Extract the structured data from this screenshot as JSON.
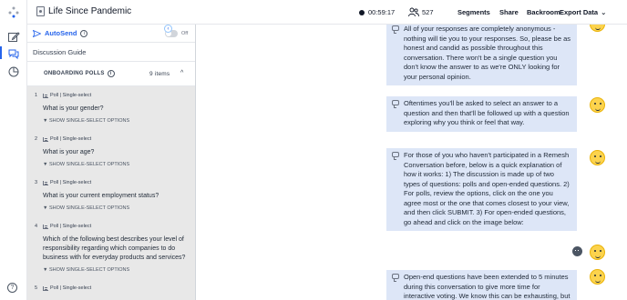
{
  "header": {
    "title": "Life Since Pandemic",
    "timer": "00:59:17",
    "participant_count": "527",
    "links": [
      "Segments",
      "Share",
      "Backroom",
      "Export Data"
    ]
  },
  "sidebar": {
    "icons": [
      "remesh-logo-icon",
      "edit-icon",
      "conversation-icon",
      "chart-icon",
      "help-icon"
    ],
    "help_glyph": "?"
  },
  "panel": {
    "autosend_label": "AutoSend",
    "toggle_state": "Off",
    "guide_title": "Discussion Guide",
    "polls_header": "ONBOARDING POLLS",
    "polls_count": "9 items",
    "polls": [
      {
        "num": "1",
        "type": "Poll | Single-select",
        "question": "What is your gender?",
        "options_label": "▼ SHOW SINGLE-SELECT OPTIONS"
      },
      {
        "num": "2",
        "type": "Poll | Single-select",
        "question": "What is your age?",
        "options_label": "▼ SHOW SINGLE-SELECT OPTIONS"
      },
      {
        "num": "3",
        "type": "Poll | Single-select",
        "question": "What is your current employment status?",
        "options_label": "▼ SHOW SINGLE-SELECT OPTIONS"
      },
      {
        "num": "4",
        "type": "Poll | Single-select",
        "question": "Which of the following best describes your level of responsibility regarding which companies to do business with for everyday products and services?",
        "options_label": "▼ SHOW SINGLE-SELECT OPTIONS"
      },
      {
        "num": "5",
        "type": "Poll | Single-select",
        "question": "",
        "options_label": ""
      }
    ]
  },
  "chat": {
    "messages": [
      {
        "text": "All of your responses are completely anonymous - nothing will tie you to your responses. So, please be as honest and candid as possible throughout this conversation. There won't be a single question you don't know the answer to as we're ONLY looking for your personal opinion."
      },
      {
        "text": "Oftentimes you'll be asked to select an answer to a question and then that'll be followed up with a question exploring why you think or feel that way."
      },
      {
        "text": "For those of you who haven't participated in a Remesh Conversation before, below is a quick explanation of how it works: 1) The discussion is made up of two types of questions: polls and open-ended questions. 2) For polls, review the options, click on the one you agree most or the one that comes closest to your view, and then click SUBMIT. 3) For open-ended questions, go ahead and click on the image below:"
      },
      {
        "text": "Open-end questions have been extended to 5 minutes during this conversation to give more time for interactive voting. We know this can be exhausting, but"
      }
    ]
  }
}
